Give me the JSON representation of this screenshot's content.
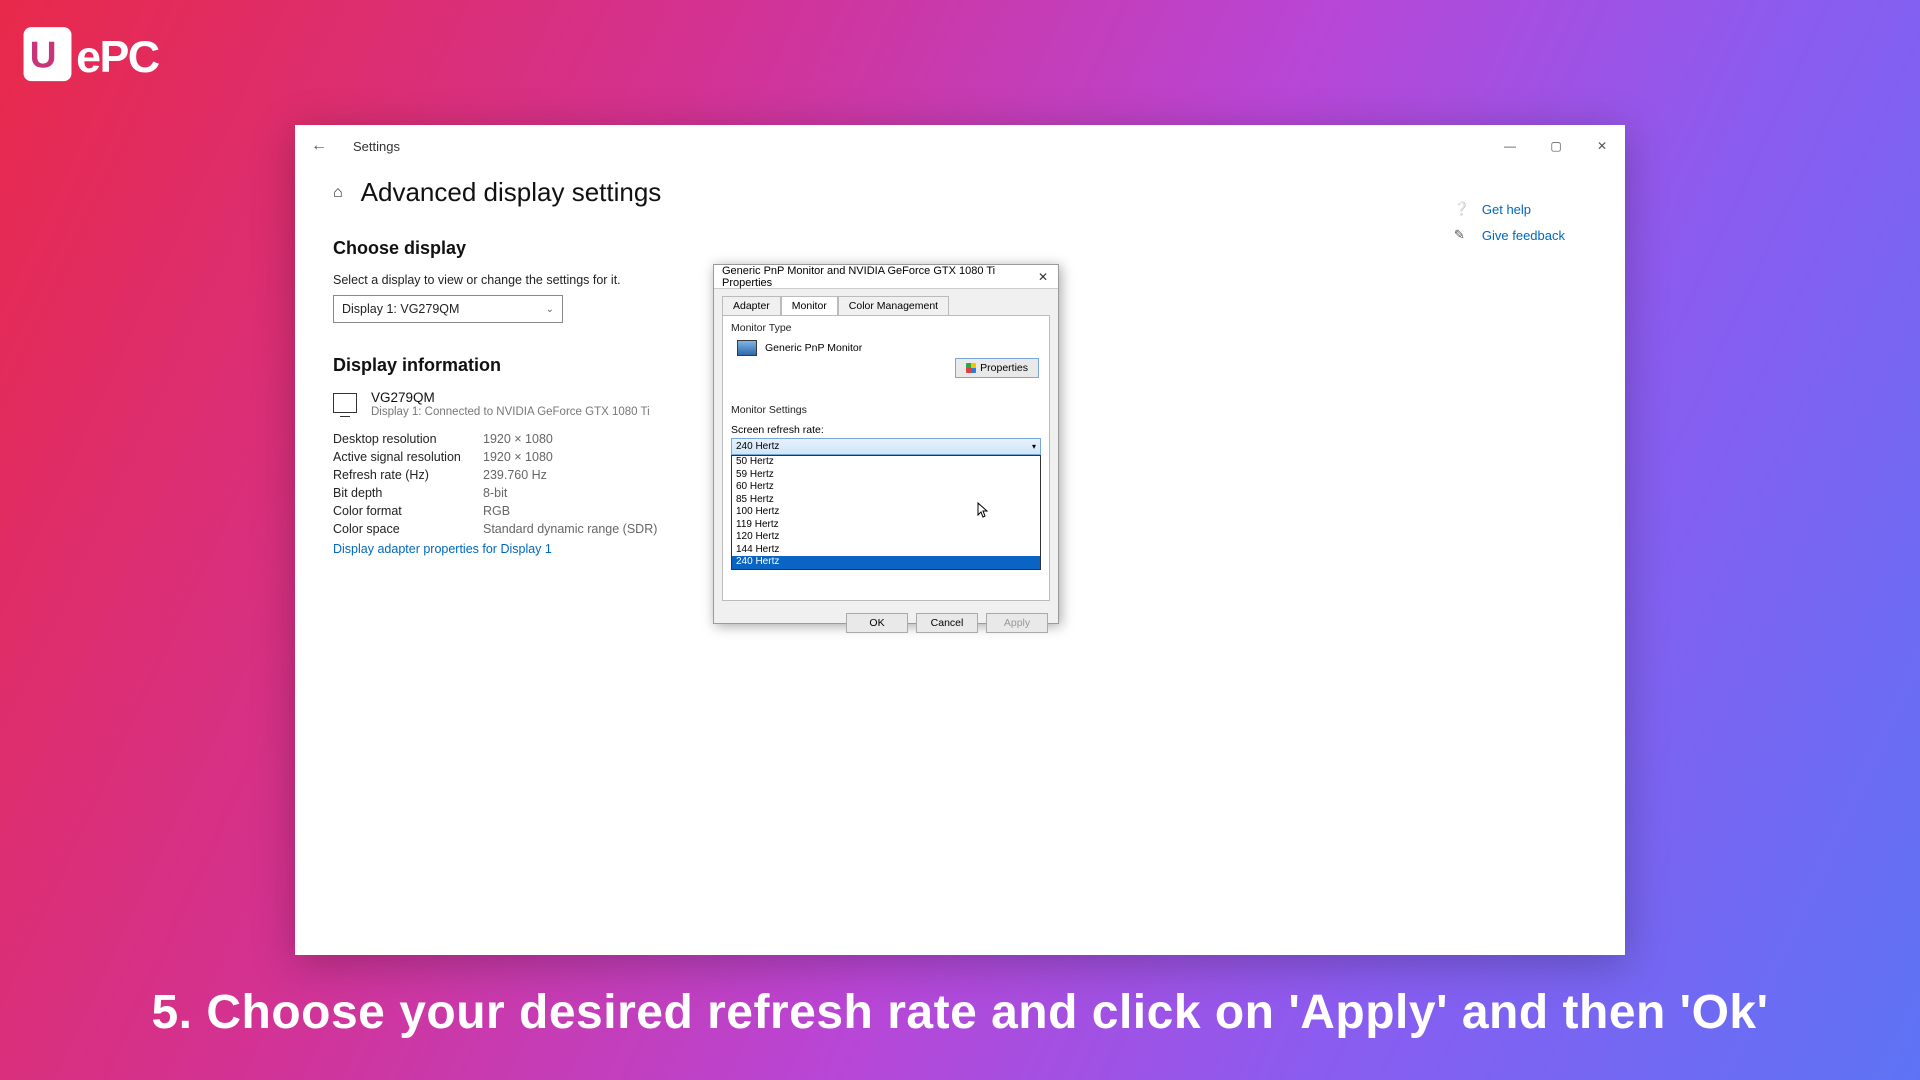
{
  "logo_alt": "WePC",
  "caption_text": "5. Choose your desired refresh rate and click on 'Apply' and then 'Ok'",
  "settings_window": {
    "title": "Settings",
    "page_heading": "Advanced display settings",
    "choose_display_heading": "Choose display",
    "choose_display_subtext": "Select a display to view or change the settings for it.",
    "selected_display": "Display 1: VG279QM",
    "display_info_heading": "Display information",
    "display_model": "VG279QM",
    "display_connection": "Display 1: Connected to NVIDIA GeForce GTX 1080 Ti",
    "info_rows": [
      {
        "label": "Desktop resolution",
        "value": "1920 × 1080"
      },
      {
        "label": "Active signal resolution",
        "value": "1920 × 1080"
      },
      {
        "label": "Refresh rate (Hz)",
        "value": "239.760 Hz"
      },
      {
        "label": "Bit depth",
        "value": "8-bit"
      },
      {
        "label": "Color format",
        "value": "RGB"
      },
      {
        "label": "Color space",
        "value": "Standard dynamic range (SDR)"
      }
    ],
    "adapter_link": "Display adapter properties for Display 1",
    "side_links": {
      "help": "Get help",
      "feedback": "Give feedback"
    }
  },
  "props_dialog": {
    "title": "Generic PnP Monitor and NVIDIA GeForce GTX 1080 Ti Properties",
    "tabs": {
      "adapter": "Adapter",
      "monitor": "Monitor",
      "color": "Color Management"
    },
    "monitor_type_label": "Monitor Type",
    "monitor_name": "Generic PnP Monitor",
    "properties_btn": "Properties",
    "monitor_settings_label": "Monitor Settings",
    "refresh_label": "Screen refresh rate:",
    "current_refresh": "240 Hertz",
    "options": [
      "50 Hertz",
      "59 Hertz",
      "60 Hertz",
      "85 Hertz",
      "100 Hertz",
      "119 Hertz",
      "120 Hertz",
      "144 Hertz",
      "240 Hertz"
    ],
    "selected_option": "240 Hertz",
    "buttons": {
      "ok": "OK",
      "cancel": "Cancel",
      "apply": "Apply"
    }
  }
}
